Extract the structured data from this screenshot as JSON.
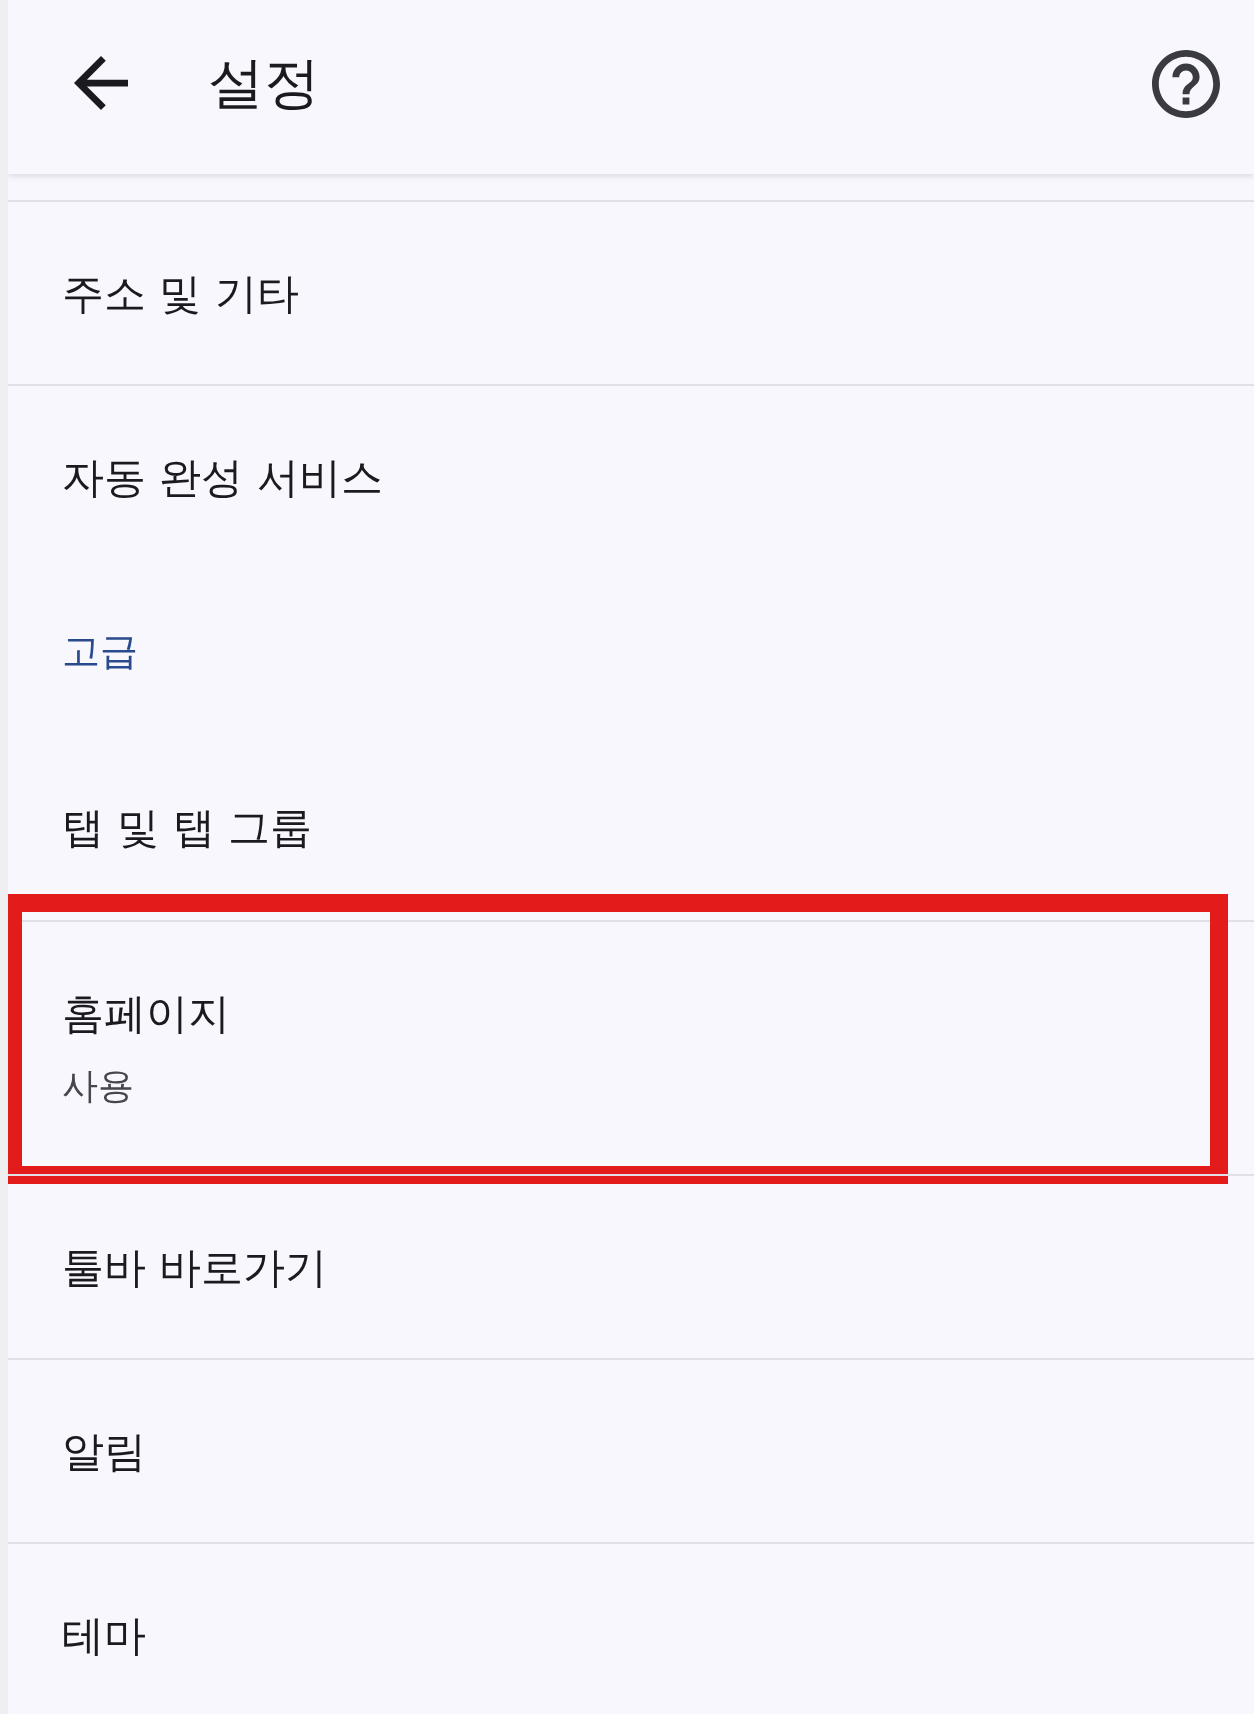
{
  "app_bar": {
    "title": "설정"
  },
  "items": [
    {
      "kind": "item",
      "label": "주소 및 기타",
      "highlighted": false
    },
    {
      "kind": "item",
      "label": "자동 완성 서비스",
      "highlighted": false
    },
    {
      "kind": "section",
      "label": "고급"
    },
    {
      "kind": "item",
      "label": "탭 및 탭 그룹",
      "highlighted": false
    },
    {
      "kind": "item",
      "label": "홈페이지",
      "summary": "사용",
      "highlighted": true
    },
    {
      "kind": "item",
      "label": "툴바 바로가기",
      "highlighted": false
    },
    {
      "kind": "item",
      "label": "알림",
      "highlighted": false
    },
    {
      "kind": "item",
      "label": "테마",
      "highlighted": false
    }
  ]
}
